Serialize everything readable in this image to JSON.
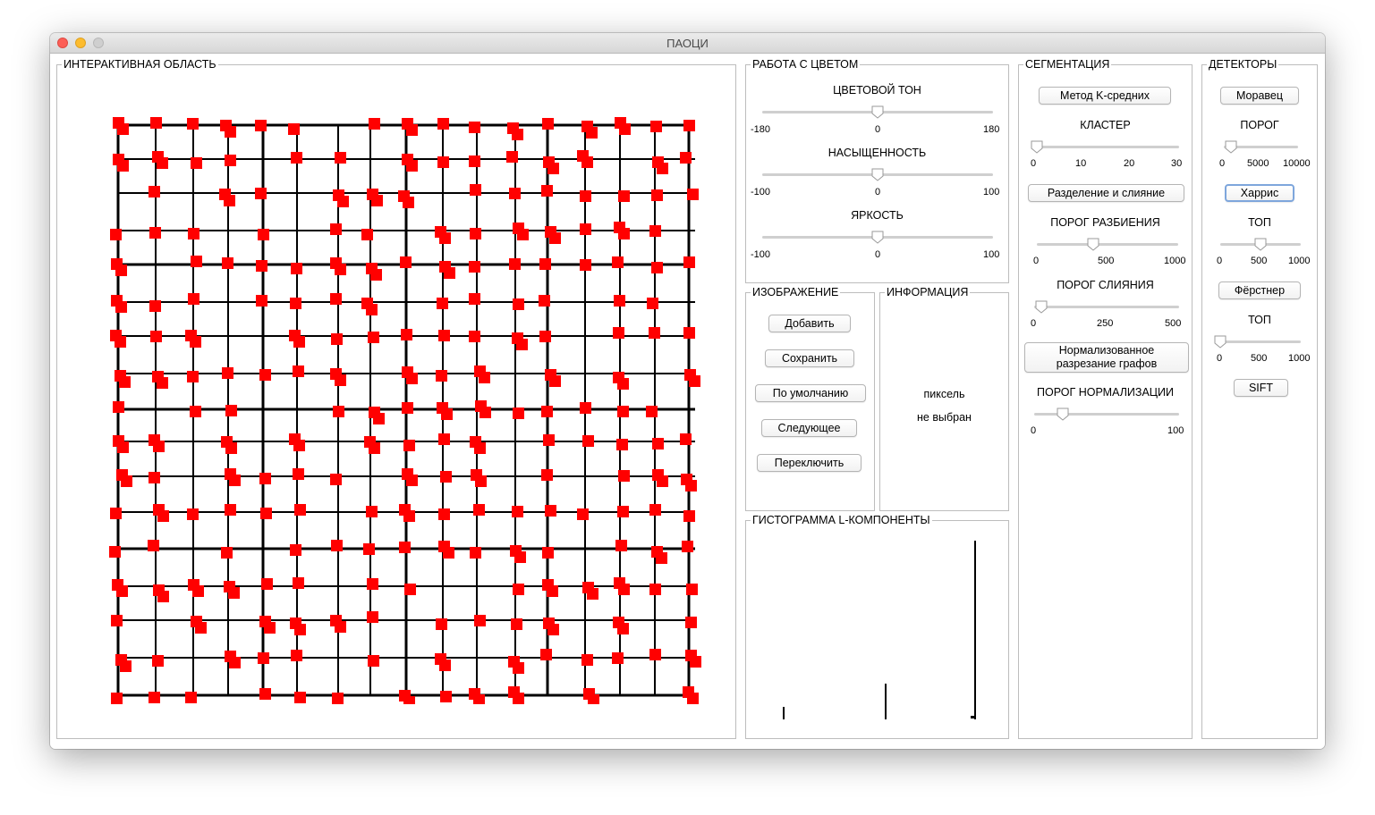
{
  "window": {
    "title": "ПАОЦИ"
  },
  "interactive": {
    "label": "ИНТЕРАКТИВНАЯ ОБЛАСТЬ"
  },
  "color": {
    "label": "РАБОТА С ЦВЕТОМ",
    "hue": {
      "label": "ЦВЕТОВОЙ ТОН",
      "min": "-180",
      "mid": "0",
      "max": "180",
      "value": 0.5
    },
    "saturation": {
      "label": "НАСЫЩЕННОСТЬ",
      "min": "-100",
      "mid": "0",
      "max": "100",
      "value": 0.5
    },
    "brightness": {
      "label": "ЯРКОСТЬ",
      "min": "-100",
      "mid": "0",
      "max": "100",
      "value": 0.5
    }
  },
  "image": {
    "label": "ИЗОБРАЖЕНИЕ",
    "add": "Добавить",
    "save": "Сохранить",
    "default": "По умолчанию",
    "next": "Следующее",
    "switch": "Переключить"
  },
  "info": {
    "label": "ИНФОРМАЦИЯ",
    "line1": "пиксель",
    "line2": "не выбран"
  },
  "histogram": {
    "label": "ГИСТОГРАММА L-КОМПОНЕНТЫ"
  },
  "segmentation": {
    "label": "СЕГМЕНТАЦИЯ",
    "kmeans": "Метод K-средних",
    "cluster": {
      "label": "КЛАСТЕР",
      "ticks": [
        "0",
        "10",
        "20",
        "30"
      ],
      "value": 0.02
    },
    "split_merge": "Разделение и слияние",
    "split_threshold": {
      "label": "ПОРОГ РАЗБИЕНИЯ",
      "ticks": [
        "0",
        "500",
        "1000"
      ],
      "value": 0.4
    },
    "merge_threshold": {
      "label": "ПОРОГ СЛИЯНИЯ",
      "ticks": [
        "0",
        "250",
        "500"
      ],
      "value": 0.05
    },
    "normalized_cut_line1": "Нормализованное",
    "normalized_cut_line2": "разрезание графов",
    "norm_threshold": {
      "label": "ПОРОГ НОРМАЛИЗАЦИИ",
      "ticks": [
        "0",
        "100"
      ],
      "value": 0.2
    }
  },
  "detectors": {
    "label": "ДЕТЕКТОРЫ",
    "moravec": "Моравец",
    "threshold": {
      "label": "ПОРОГ",
      "ticks": [
        "0",
        "5000",
        "10000"
      ],
      "value": 0.1
    },
    "harris": "Харрис",
    "top1": {
      "label": "ТОП",
      "ticks": [
        "0",
        "500",
        "1000"
      ],
      "value": 0.5
    },
    "forstner": "Фёрстнер",
    "top2": {
      "label": "ТОП",
      "ticks": [
        "0",
        "500",
        "1000"
      ],
      "value": 0.0
    },
    "sift": "SIFT"
  }
}
